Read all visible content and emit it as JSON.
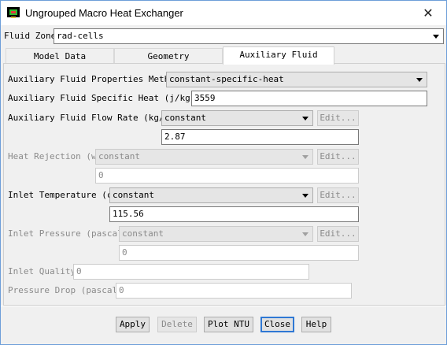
{
  "window": {
    "title": "Ungrouped Macro Heat Exchanger",
    "close_glyph": "✕"
  },
  "fluid_zone": {
    "label": "Fluid Zone",
    "value": "rad-cells"
  },
  "tabs": [
    {
      "label": "Model Data",
      "active": false
    },
    {
      "label": "Geometry",
      "active": false
    },
    {
      "label": "Auxiliary Fluid",
      "active": true
    }
  ],
  "aux": {
    "method": {
      "label": "Auxiliary Fluid Properties Method",
      "value": "constant-specific-heat"
    },
    "specific_heat": {
      "label": "Auxiliary Fluid Specific Heat (j/kg-k)",
      "value": "3559"
    },
    "flow_rate": {
      "label": "Auxiliary Fluid Flow Rate (kg/s)",
      "mode": "constant",
      "edit": "Edit...",
      "value": "2.87"
    },
    "heat_rejection": {
      "label": "Heat Rejection (w)",
      "mode": "constant",
      "edit": "Edit...",
      "value": "0"
    },
    "inlet_temperature": {
      "label": "Inlet Temperature (c)",
      "mode": "constant",
      "edit": "Edit...",
      "value": "115.56"
    },
    "inlet_pressure": {
      "label": "Inlet Pressure (pascal)",
      "mode": "constant",
      "edit": "Edit...",
      "value": "0"
    },
    "inlet_quality": {
      "label": "Inlet Quality",
      "value": "0"
    },
    "pressure_drop": {
      "label": "Pressure Drop (pascal)",
      "value": "0"
    }
  },
  "buttons": {
    "apply": "Apply",
    "delete": "Delete",
    "plot_ntu": "Plot NTU",
    "close": "Close",
    "help": "Help"
  },
  "icons": {
    "app": "heat-exchanger-app-icon",
    "close": "close-icon",
    "dropdown": "chevron-down-icon"
  }
}
